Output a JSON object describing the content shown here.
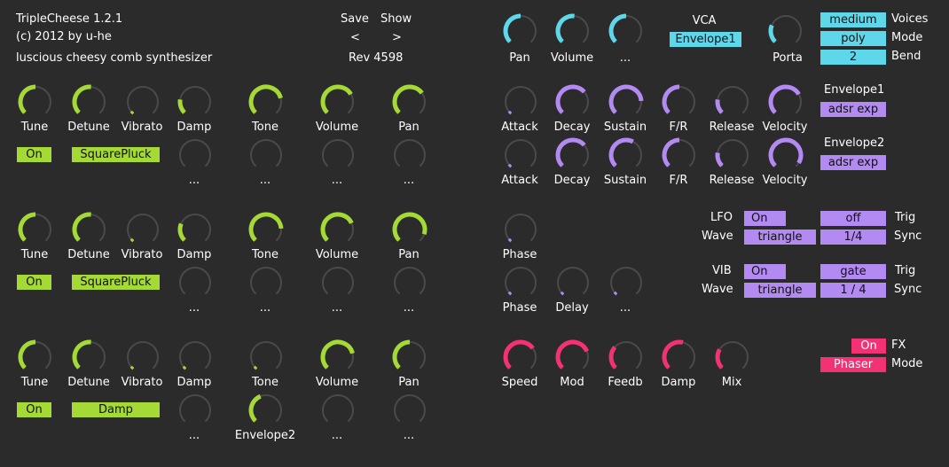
{
  "header": {
    "title": "TripleCheese 1.2.1",
    "copyright": "(c) 2012 by u-he",
    "subtitle": "luscious cheesy comb synthesizer",
    "save_label": "Save",
    "show_label": "Show",
    "prev_label": "<",
    "next_label": ">",
    "rev_label": "Rev 4598"
  },
  "colors": {
    "green": "#a4d936",
    "cyan": "#5fd7ea",
    "purple": "#b389f2",
    "pink": "#f33275",
    "knob_ring": "#4a4a4a",
    "background": "#2b2b2b"
  },
  "knob_labels": {
    "tune": "Tune",
    "detune": "Detune",
    "vibrato": "Vibrato",
    "damp": "Damp",
    "tone": "Tone",
    "volume": "Volume",
    "pan": "Pan",
    "more": "...",
    "attack": "Attack",
    "decay": "Decay",
    "sustain": "Sustain",
    "fr": "F/R",
    "release": "Release",
    "velocity": "Velocity",
    "phase": "Phase",
    "delay": "Delay",
    "porta": "Porta",
    "speed": "Speed",
    "mod": "Mod",
    "feedb": "Feedb",
    "mix": "Mix",
    "envelope2": "Envelope2"
  },
  "combs": [
    {
      "on_label": "On",
      "model_label": "SquarePluck"
    },
    {
      "on_label": "On",
      "model_label": "SquarePluck"
    },
    {
      "on_label": "On",
      "model_label": "Damp"
    }
  ],
  "vca": {
    "title": "VCA",
    "source_label": "Envelope1"
  },
  "global": {
    "voices_value": "medium",
    "voices_label": "Voices",
    "mode_value": "poly",
    "mode_label": "Mode",
    "bend_value": "2",
    "bend_label": "Bend"
  },
  "envelopes": {
    "env1_title": "Envelope1",
    "env1_mode": "adsr exp",
    "env2_title": "Envelope2",
    "env2_mode": "adsr exp"
  },
  "lfo": {
    "title": "LFO",
    "on_label": "On",
    "trig_value": "off",
    "trig_label": "Trig",
    "wave_label": "Wave",
    "wave_value": "triangle",
    "sync_value": "1/4",
    "sync_label": "Sync"
  },
  "vib": {
    "title": "VIB",
    "on_label": "On",
    "trig_value": "gate",
    "trig_label": "Trig",
    "wave_label": "Wave",
    "wave_value": "triangle",
    "sync_value": "1 / 4",
    "sync_label": "Sync"
  },
  "fx": {
    "on_label": "On",
    "fx_label": "FX",
    "mode_value": "Phaser",
    "mode_label": "Mode"
  }
}
